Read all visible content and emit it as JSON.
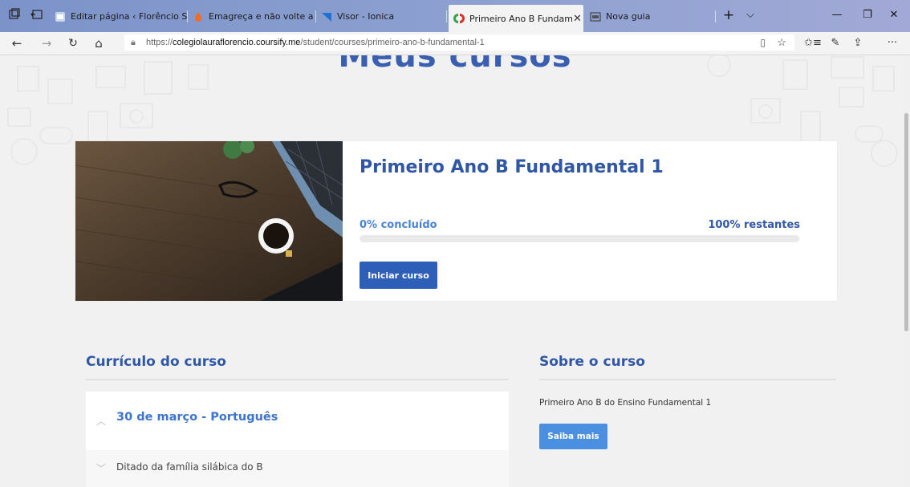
{
  "browser": {
    "tabs": [
      {
        "title": "Editar página ‹ Florêncio Sis"
      },
      {
        "title": "Emagreça e não volte a eng"
      },
      {
        "title": "Visor - Ionica"
      },
      {
        "title": "Primeiro Ano B Fundam"
      },
      {
        "title": "Nova guia"
      }
    ],
    "url_scheme": "https://",
    "url_host": "colegiolauraflorencio.coursify.me",
    "url_path": "/student/courses/primeiro-ano-b-fundamental-1"
  },
  "page": {
    "hero_title": "Meus cursos",
    "course": {
      "title": "Primeiro Ano B Fundamental 1",
      "completed_label": "0% concluído",
      "remaining_label": "100% restantes",
      "progress_fraction": 0,
      "start_button": "Iniciar curso"
    },
    "curriculum": {
      "title": "Currículo do curso",
      "chapter": "30 de março - Português",
      "lesson": "Ditado da família silábica do B"
    },
    "about": {
      "title": "Sobre o curso",
      "text": "Primeiro Ano B do Ensino Fundamental 1",
      "button": "Saiba mais"
    }
  },
  "colors": {
    "tabbar": "#8ea1d1",
    "primary": "#2e5fb8",
    "accent": "#4a8fe0",
    "heading": "#2f57a6"
  }
}
